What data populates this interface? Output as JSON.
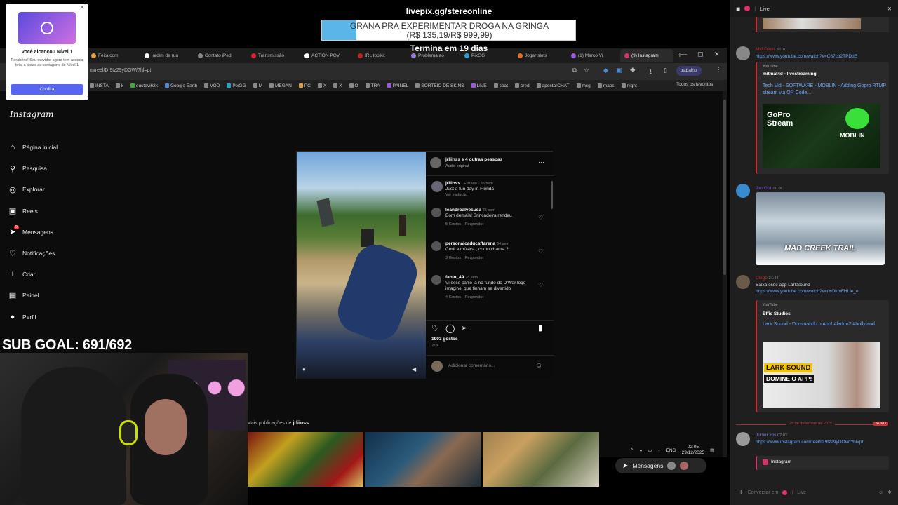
{
  "overlay": {
    "livepix_url": "livepix.gg/stereonline",
    "goal_title": "GRANA PRA EXPERIMENTAR DROGA NA GRINGA",
    "goal_amount": "(R$ 135,19/R$ 999,99)",
    "goal_progress": 0.135,
    "ends_in": "Termina em 19 dias",
    "sub_goal": "SUB GOAL: 691/692"
  },
  "notification": {
    "title": "Você alcançou Nível 1",
    "body": "Parabéns! Seu servidor agora tem acesso total a todas as vantagens de Nível 1",
    "button": "Confira"
  },
  "browser": {
    "tabs": [
      {
        "label": "Feita com",
        "color": "#e0a040"
      },
      {
        "label": "jardim de rua",
        "color": "#ffffff"
      },
      {
        "label": "Contato iPed",
        "color": "#888888"
      },
      {
        "label": "Transmissão",
        "color": "#e02030"
      },
      {
        "label": "ACTION POV",
        "color": "#ffffff"
      },
      {
        "label": "IRL toolkit",
        "color": "#c02020"
      },
      {
        "label": "Problema ao",
        "color": "#9a7adf"
      },
      {
        "label": "PixGG",
        "color": "#2aa0d0"
      },
      {
        "label": "Jogar slots",
        "color": "#e07020"
      },
      {
        "label": "(1) Marco Vi",
        "color": "#9a5adf"
      },
      {
        "label": "(9) Instagram",
        "color": "#d6336c",
        "active": true
      }
    ],
    "url": "m/reel/DI9tz29yDOW/?hl=pt",
    "profile": "trabalho",
    "bookmarks": [
      {
        "label": "INSTA",
        "color": "#888"
      },
      {
        "label": "k",
        "color": "#888"
      },
      {
        "label": "eustevi62k",
        "color": "#3aaa3a"
      },
      {
        "label": "Google Earth",
        "color": "#4a8ae0"
      },
      {
        "label": "VOD",
        "color": "#888"
      },
      {
        "label": "PixGG",
        "color": "#2aa0d0"
      },
      {
        "label": "M",
        "color": "#888"
      },
      {
        "label": "MEGAN",
        "color": "#888"
      },
      {
        "label": "PC",
        "color": "#e0a040"
      },
      {
        "label": "X",
        "color": "#888"
      },
      {
        "label": "X",
        "color": "#888"
      },
      {
        "label": "O",
        "color": "#888"
      },
      {
        "label": "TRA",
        "color": "#888"
      },
      {
        "label": "PAINEL",
        "color": "#9a5adf"
      },
      {
        "label": "SORTEIO DE SKINS",
        "color": "#888"
      },
      {
        "label": "LIVE",
        "color": "#9a5adf"
      },
      {
        "label": "cbat",
        "color": "#888"
      },
      {
        "label": "cred",
        "color": "#888"
      },
      {
        "label": "apostarCHAT",
        "color": "#888"
      },
      {
        "label": "msg",
        "color": "#888"
      },
      {
        "label": "maps",
        "color": "#888"
      },
      {
        "label": "night",
        "color": "#888"
      }
    ],
    "bookmarks_all": "Todos os favoritos"
  },
  "instagram": {
    "logo": "Instagram",
    "nav": [
      {
        "label": "Página inicial",
        "icon": "home-icon",
        "glyph": "⌂"
      },
      {
        "label": "Pesquisa",
        "icon": "search-icon",
        "glyph": "⚲"
      },
      {
        "label": "Explorar",
        "icon": "compass-icon",
        "glyph": "◎"
      },
      {
        "label": "Reels",
        "icon": "reels-icon",
        "glyph": "▣"
      },
      {
        "label": "Mensagens",
        "icon": "messages-icon",
        "glyph": "➤"
      },
      {
        "label": "Notificações",
        "icon": "heart-icon",
        "glyph": "♡"
      },
      {
        "label": "Criar",
        "icon": "plus-icon",
        "glyph": "+"
      },
      {
        "label": "Painel",
        "icon": "dashboard-icon",
        "glyph": "▤"
      },
      {
        "label": "Perfil",
        "icon": "profile-icon",
        "glyph": "●"
      }
    ],
    "post": {
      "header": "jrliinss e 4 outras pessoas",
      "audio": "Áudio original",
      "caption_user": "jrliinss",
      "caption_meta": "· Editado · 35 sem",
      "caption": "Just a fun day in Florida",
      "see_translation": "Ver tradução",
      "comments": [
        {
          "user": "leandroalvesusa",
          "time": "35 sem",
          "text": "Bom demais! Brincadeira rendeu",
          "likes": "5 Gostos",
          "reply": "Responder"
        },
        {
          "user": "personalcaducaffarena",
          "time": "34 sem",
          "text": "Curti a música , como chama ?",
          "likes": "3 Gostos",
          "reply": "Responder"
        },
        {
          "user": "fabio_49",
          "time": "28 sem",
          "text": "Vi esse carro lá no fundo do D'War logo imaginei que tinham se divertido",
          "likes": "4 Gostos",
          "reply": "Responder"
        }
      ],
      "likes": "1903 gostos",
      "date": "27/4",
      "comment_placeholder": "Adicionar comentário..."
    },
    "more_posts_prefix": "Mais publicações de",
    "more_posts_user": "jrliinss",
    "messages_button": "Mensagens",
    "messages_badge": "9"
  },
  "taskbar": {
    "lang": "ENG",
    "time": "02:05",
    "date": "29/12/2025"
  },
  "chat": {
    "title": "Live",
    "messages": [
      {
        "name": "Mid Deco",
        "time": "20:07",
        "link": "https://www.youtube.com/watch?v=C67cb2TPDdE",
        "embed_provider": "YouTube",
        "embed_author": "mitmat4d - livestreaming",
        "embed_title": "Tech Vid - SOFTWARE - MOBLIN - Adding Gopro RTMP stream via QR Code...",
        "thumb_text_1": "GoPro Stream",
        "thumb_text_2": "MOBLIN"
      },
      {
        "name": "Jim Gol",
        "time": "21:28",
        "thumb_text": "MAD CREEK TRAIL"
      },
      {
        "name": "Diego",
        "time": "21:44",
        "text": "Baixa esse app LarkSound",
        "link": "https://www.youtube.com/watch?v=rYOkmFHLie_o",
        "embed_provider": "YouTube",
        "embed_author": "Effic Studios",
        "embed_title": "Lark Sound - Dominando o App! #larkm2 #hollyland",
        "thumb_text_1": "LARK SOUND",
        "thumb_text_2": "DOMINE O APP!"
      },
      {
        "name": "Junior lins",
        "time": "02:03",
        "link": "https://www.instagram.com/reel/DI9tz29yDOW/?hl=pt",
        "embed_label": "Instagram"
      }
    ],
    "divider_date": "29 de dezembro de 2025",
    "divider_badge": "NOVO",
    "input_placeholder": "Conversar em",
    "input_channel": "Live"
  }
}
